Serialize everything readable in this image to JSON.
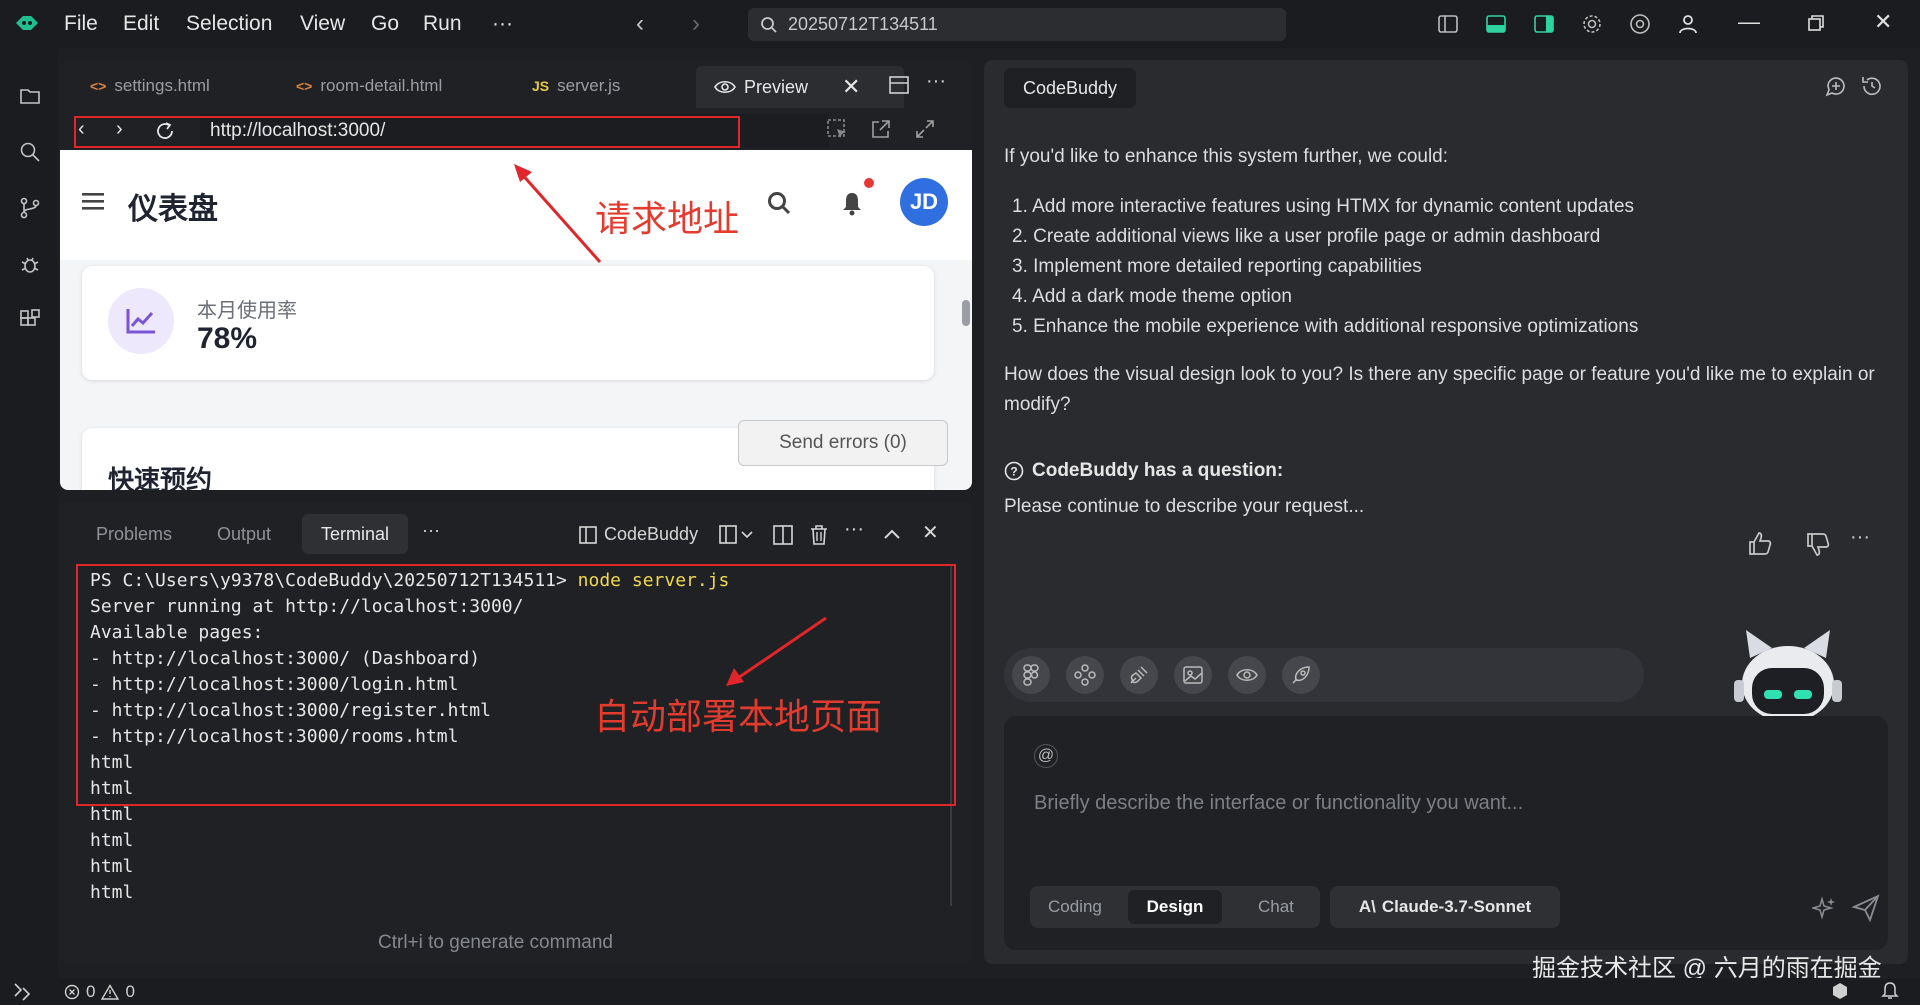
{
  "titlebar": {
    "menu": [
      "File",
      "Edit",
      "Selection",
      "View",
      "Go",
      "Run",
      "···"
    ],
    "search_text": "20250712T134511"
  },
  "editor": {
    "tabs": [
      {
        "label": "settings.html",
        "icon": "html-icon"
      },
      {
        "label": "room-detail.html",
        "icon": "html-icon"
      },
      {
        "label": "server.js",
        "icon": "js-icon",
        "icon_text": "JS"
      }
    ],
    "preview_tab": "Preview",
    "url": "http://localhost:3000/",
    "html_icon_text": "<>"
  },
  "preview": {
    "title": "仪表盘",
    "avatar": "JD",
    "card_label": "本月使用率",
    "card_value": "78%",
    "section_title": "快速预约",
    "send_errors": "Send errors (0)"
  },
  "annotations": {
    "url_label": "请求地址",
    "deploy_label": "自动部署本地页面",
    "color": "#e33b2e"
  },
  "panel": {
    "tabs": [
      "Problems",
      "Output",
      "Terminal"
    ],
    "more": "···",
    "codebuddy_label": "CodeBuddy",
    "hint": "Ctrl+i to generate command",
    "terminal": {
      "prompt": "PS C:\\Users\\y9378\\CodeBuddy\\20250712T134511> ",
      "command": "node server.js",
      "lines": [
        "Server running at http://localhost:3000/",
        "Available pages:",
        "- http://localhost:3000/ (Dashboard)",
        "- http://localhost:3000/login.html",
        "- http://localhost:3000/register.html",
        "- http://localhost:3000/rooms.html",
        "html",
        "html",
        "html",
        "html",
        "html",
        "html"
      ]
    }
  },
  "codebuddy": {
    "tab": "CodeBuddy",
    "intro": "If you'd like to enhance this system further, we could:",
    "list": [
      "1. Add more interactive features using HTMX for dynamic content updates",
      "2. Create additional views like a user profile page or admin dashboard",
      "3. Implement more detailed reporting capabilities",
      "4. Add a dark mode theme option",
      "5. Enhance the mobile experience with additional responsive optimizations"
    ],
    "question_text": "How does the visual design look to you? Is there any specific page or feature you'd like me to explain or modify?",
    "question_title": "CodeBuddy has a question:",
    "question_body": "Please continue to describe your request...",
    "more": "···",
    "at_symbol": "@",
    "placeholder": "Briefly describe the interface or functionality you want...",
    "modes": [
      "Coding",
      "Design",
      "Chat"
    ],
    "active_mode": "Design",
    "model": "Claude-3.7-Sonnet",
    "model_icon": "A\\"
  },
  "status": {
    "errors": "0",
    "warnings": "0"
  },
  "watermark": "掘金技术社区 @ 六月的雨在掘金"
}
